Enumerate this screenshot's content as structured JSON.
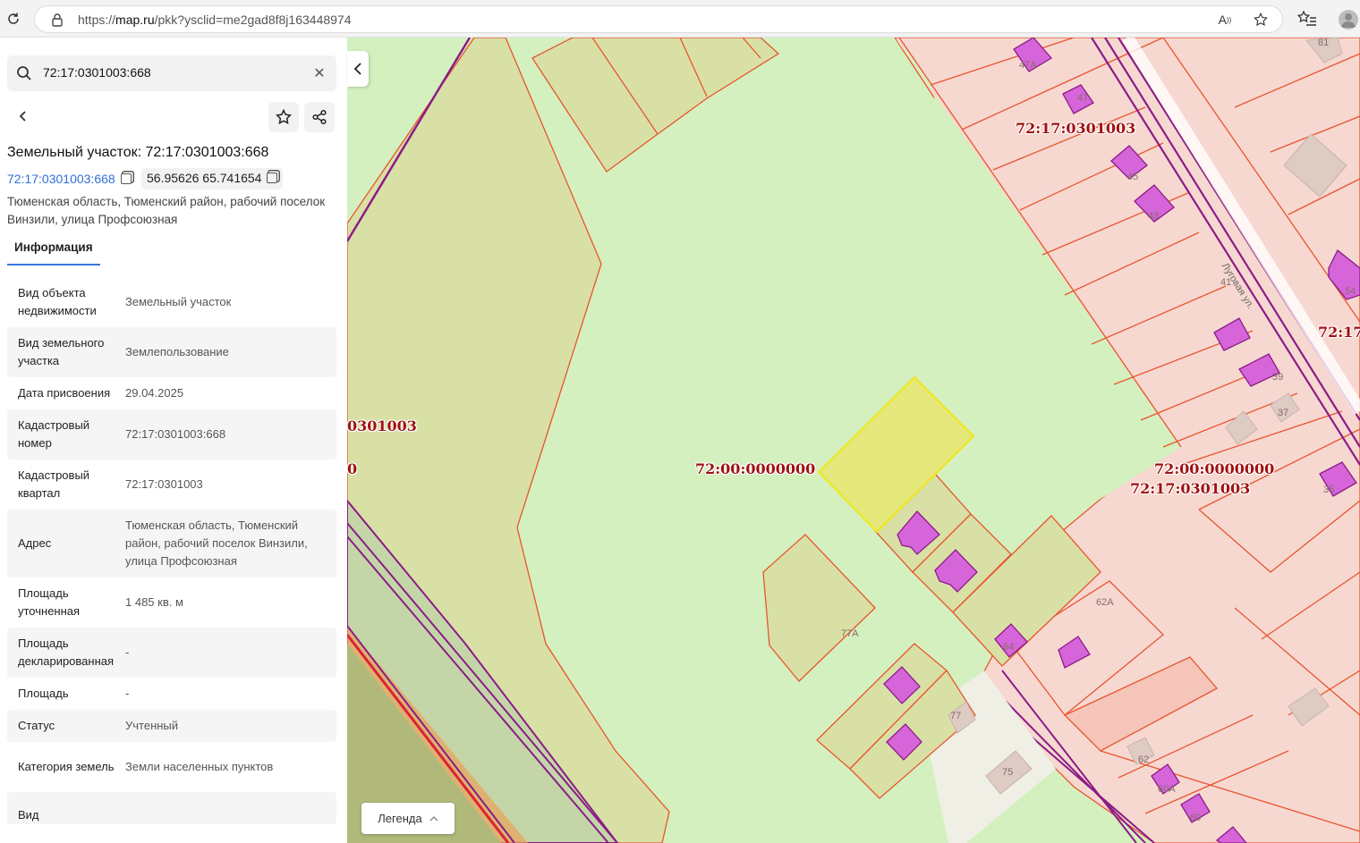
{
  "browser": {
    "url_prefix": "https://",
    "url_domain": "map.ru",
    "url_rest": "/pkk?ysclid=me2gad8f8j163448974"
  },
  "panel": {
    "search_value": "72:17:0301003:668",
    "title": "Земельный участок: 72:17:0301003:668",
    "cad_number_link": "72:17:0301003:668",
    "coordinates": "56.95626 65.741654",
    "address": "Тюменская область, Тюменский район, рабочий поселок Винзили, улица Профсоюзная",
    "tab_info": "Информация",
    "rows": [
      {
        "k": "Вид объекта недвижимости",
        "v": "Земельный участок"
      },
      {
        "k": "Вид земельного участка",
        "v": "Землепользование"
      },
      {
        "k": "Дата присвоения",
        "v": "29.04.2025"
      },
      {
        "k": "Кадастровый номер",
        "v": "72:17:0301003:668"
      },
      {
        "k": "Кадастровый квартал",
        "v": "72:17:0301003"
      },
      {
        "k": "Адрес",
        "v": "Тюменская область, Тюменский район, рабочий поселок Винзили, улица Профсоюзная"
      },
      {
        "k": "Площадь уточненная",
        "v": "1 485 кв. м"
      },
      {
        "k": "Площадь декларированная",
        "v": "-"
      },
      {
        "k": "Площадь",
        "v": "-"
      },
      {
        "k": "Статус",
        "v": "Учтенный"
      },
      {
        "k": "Категория земель",
        "v": "Земли населенных пунктов"
      },
      {
        "k": "Вид",
        "v": ""
      }
    ]
  },
  "map": {
    "legend_label": "Легенда",
    "labels": {
      "q1": "72:17:0301003",
      "q2": "0301003",
      "q3": "0",
      "q4": "72:00:0000000",
      "q5": "72:00:0000000",
      "q6": "72:17:0301003",
      "q7": "72:17"
    },
    "house_numbers": {
      "h47a": "47А",
      "h47": "47",
      "h45": "45",
      "h43": "43",
      "h41": "41",
      "h39": "39",
      "h37": "37",
      "h35": "35",
      "h54": "54",
      "h81": "81",
      "h62a": "62А",
      "h64": "64",
      "h77a": "77А",
      "h77": "77",
      "h75": "75",
      "h62": "62",
      "h60a": "60А",
      "h60": "60"
    },
    "street_name": "Луговая ул."
  }
}
